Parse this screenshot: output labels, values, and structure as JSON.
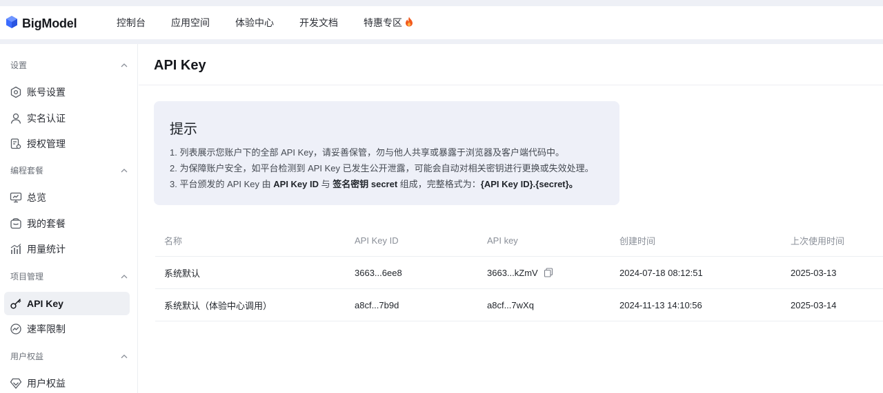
{
  "brand": {
    "name": "BigModel",
    "color": "#3b6cff"
  },
  "nav": {
    "items": [
      {
        "label": "控制台"
      },
      {
        "label": "应用空间"
      },
      {
        "label": "体验中心"
      },
      {
        "label": "开发文档"
      },
      {
        "label": "特惠专区",
        "icon": "fire-icon"
      }
    ]
  },
  "sidebar": {
    "groups": [
      {
        "title": "设置",
        "items": [
          {
            "label": "账号设置",
            "icon": "account-settings-icon"
          },
          {
            "label": "实名认证",
            "icon": "user-icon"
          },
          {
            "label": "授权管理",
            "icon": "authorization-icon"
          }
        ]
      },
      {
        "title": "编程套餐",
        "items": [
          {
            "label": "总览",
            "icon": "monitor-icon"
          },
          {
            "label": "我的套餐",
            "icon": "package-icon"
          },
          {
            "label": "用量统计",
            "icon": "bar-chart-icon"
          }
        ]
      },
      {
        "title": "项目管理",
        "items": [
          {
            "label": "API Key",
            "icon": "key-icon",
            "active": true
          },
          {
            "label": "速率限制",
            "icon": "speedometer-icon"
          }
        ]
      },
      {
        "title": "用户权益",
        "items": [
          {
            "label": "用户权益",
            "icon": "diamond-icon"
          }
        ]
      }
    ]
  },
  "main": {
    "title": "API Key",
    "tip": {
      "title": "提示",
      "line1": "1. 列表展示您账户下的全部 API Key，请妥善保管，勿与他人共享或暴露于浏览器及客户端代码中。",
      "line2": "2. 为保障账户安全，如平台检测到 API Key 已发生公开泄露，可能会自动对相关密钥进行更换或失效处理。",
      "line3_parts": {
        "a": "3. 平台颁发的 API Key 由 ",
        "b": "API Key ID",
        "c": " 与 ",
        "d": "签名密钥 secret",
        "e": " 组成，完整格式为：",
        "f": "{API Key ID}.{secret}。"
      }
    },
    "table": {
      "headers": [
        "名称",
        "API Key ID",
        "API key",
        "创建时间",
        "上次使用时间"
      ],
      "rows": [
        {
          "name": "系统默认",
          "key_id": "3663...6ee8",
          "api_key": "3663...kZmV",
          "created": "2024-07-18 08:12:51",
          "last_used": "2025-03-13"
        },
        {
          "name": "系统默认（体验中心调用）",
          "key_id": "a8cf...7b9d",
          "api_key": "a8cf...7wXq",
          "created": "2024-11-13 14:10:56",
          "last_used": "2025-03-14"
        }
      ]
    }
  }
}
